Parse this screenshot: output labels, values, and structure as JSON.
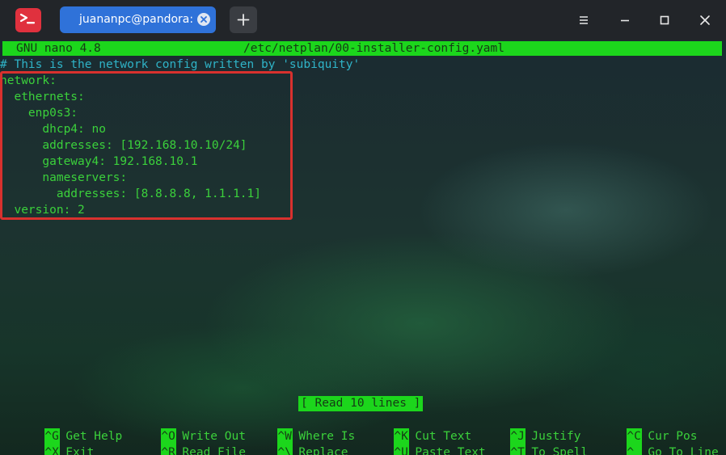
{
  "titlebar": {
    "tab_title": "juananpc@pandora: ~",
    "app_icon": "terminal-icon",
    "new_tab_icon": "plus-icon",
    "buttons": [
      "hamburger-menu-icon",
      "minimize-icon",
      "maximize-icon",
      "close-icon"
    ]
  },
  "nano": {
    "version": "GNU nano 4.8",
    "file_path": "/etc/netplan/00-installer-config.yaml",
    "lines": [
      "# This is the network config written by 'subiquity'",
      "network:",
      "  ethernets:",
      "    enp0s3:",
      "      dhcp4: no",
      "      addresses: [192.168.10.10/24]",
      "      gateway4: 192.168.10.1",
      "      nameservers:",
      "        addresses: [8.8.8.8, 1.1.1.1]",
      "  version: 2"
    ],
    "status": "[ Read 10 lines ]",
    "shortcuts_row1": [
      {
        "key": "^G",
        "label": "Get Help"
      },
      {
        "key": "^O",
        "label": "Write Out"
      },
      {
        "key": "^W",
        "label": "Where Is"
      },
      {
        "key": "^K",
        "label": "Cut Text"
      },
      {
        "key": "^J",
        "label": "Justify"
      },
      {
        "key": "^C",
        "label": "Cur Pos"
      }
    ],
    "shortcuts_row2": [
      {
        "key": "^X",
        "label": "Exit"
      },
      {
        "key": "^R",
        "label": "Read File"
      },
      {
        "key": "^\\",
        "label": "Replace"
      },
      {
        "key": "^U",
        "label": "Paste Text"
      },
      {
        "key": "^T",
        "label": "To Spell"
      },
      {
        "key": "^_",
        "label": "Go To Line"
      }
    ]
  },
  "colors": {
    "accent_tab": "#2f72d9",
    "app_icon": "#e0313e",
    "nano_green": "#1cd61c",
    "text_green": "#3bd13b",
    "comment": "#2fb3c7",
    "highlight": "#d8312e"
  }
}
